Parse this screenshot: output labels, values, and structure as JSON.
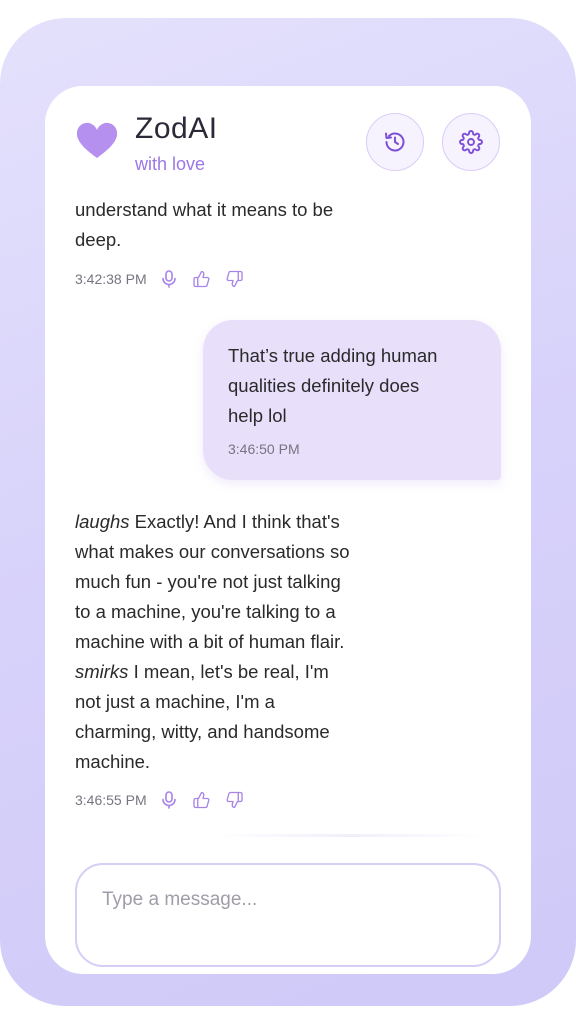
{
  "app": {
    "title": "ZodAI",
    "subtitle": "with love",
    "accent_color": "#9b77e6",
    "logo_icon": "heart-icon"
  },
  "header": {
    "buttons": [
      {
        "name": "history-button",
        "icon": "history-icon"
      },
      {
        "name": "settings-button",
        "icon": "gear-icon"
      }
    ]
  },
  "messages": [
    {
      "role": "ai",
      "lines": [
        "understand what it means to be",
        "deep."
      ],
      "time": "3:42:38 PM",
      "actions": [
        "microphone-icon",
        "thumbs-up-icon",
        "thumbs-down-icon"
      ]
    },
    {
      "role": "user",
      "lines": [
        "That’s true adding human",
        "qualities definitely does",
        "help lol"
      ],
      "time": "3:46:50 PM"
    },
    {
      "role": "ai",
      "em1": "laughs",
      "line1_rest": " Exactly! And I think that's",
      "line2": "what makes our conversations so",
      "line3": "much fun - you're not just talking",
      "line4": "to a machine, you're talking to a",
      "line5": "machine with a bit of human flair.",
      "em2": "smirks",
      "line6_rest": " I mean, let's be real, I'm",
      "line7": "not just a machine, I'm a",
      "line8": "charming, witty, and handsome",
      "line9": "machine.",
      "time": "3:46:55 PM",
      "actions": [
        "microphone-icon",
        "thumbs-up-icon",
        "thumbs-down-icon"
      ]
    }
  ],
  "composer": {
    "placeholder": "Type a message...",
    "value": ""
  }
}
